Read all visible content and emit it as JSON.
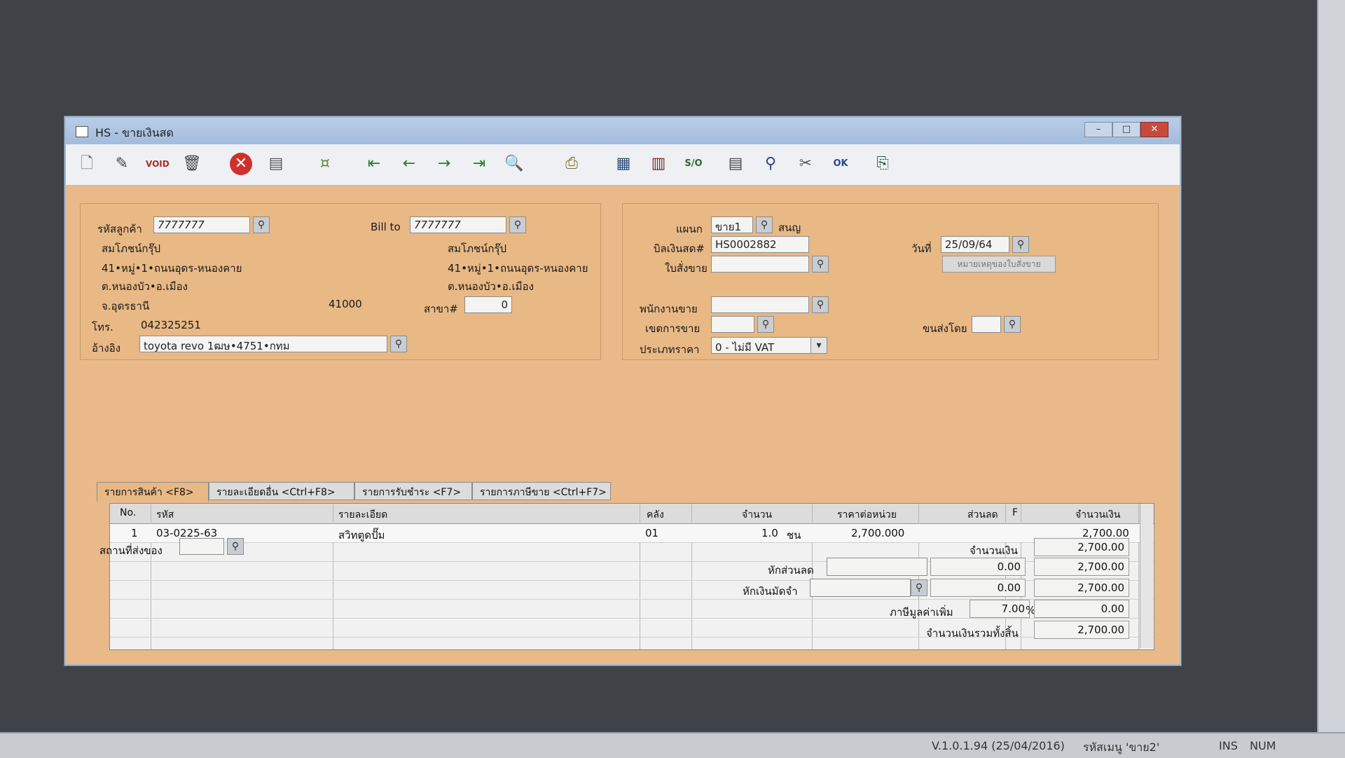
{
  "window": {
    "title": "HS - ขายเงินสด"
  },
  "toolbar": {
    "icons": [
      "new-icon",
      "edit-icon",
      "void-icon",
      "trash-icon",
      "cancel-icon",
      "save-icon",
      "money-icon",
      "first-icon",
      "prev-icon",
      "next-icon",
      "last-icon",
      "preview-icon",
      "print-icon",
      "report-icon",
      "card-icon",
      "so-icon",
      "document-icon",
      "lookup-icon",
      "tools-icon",
      "ok-icon",
      "export-icon"
    ]
  },
  "customer": {
    "code_label": "รหัสลูกค้า",
    "code": "7777777",
    "billto_label": "Bill to",
    "billto": "7777777",
    "name": "สมโภชน์กรุ๊ป",
    "addr1": "41•หมู่•1•ถนนอุดร-หนองคาย",
    "addr2": "ต.หนองบัว•อ.เมือง",
    "addr3": "จ.อุดรธานี",
    "zip": "41000",
    "branch_label": "สาขา#",
    "branch": "0",
    "phone_label": "โทร.",
    "phone": "042325251",
    "ref_label": "อ้างอิง",
    "ref": "toyota revo 1ฒษ•4751•กทม",
    "bill_name": "สมโภชน์กรุ๊ป",
    "bill_addr1": "41•หมู่•1•ถนนอุดร-หนองคาย",
    "bill_addr2": "ต.หนองบัว•อ.เมือง"
  },
  "doc": {
    "dept_label": "แผนก",
    "dept": "ขาย1",
    "dept_name": "สนญ",
    "bill_label": "บิลเงินสด#",
    "bill": "HS0002882",
    "date_label": "วันที่",
    "date": "25/09/64",
    "so_label": "ใบสั่งขาย",
    "so_note_btn": "หมายเหตุของใบสั่งขาย",
    "sales_label": "พนักงานขาย",
    "area_label": "เขตการขาย",
    "ship_label": "ขนส่งโดย",
    "price_type_label": "ประเภทราคา",
    "price_type": "0 - ไม่มี VAT"
  },
  "tabs": [
    "รายการสินค้า <F8>",
    "รายละเอียดอื่น <Ctrl+F8>",
    "รายการรับชำระ <F7>",
    "รายการภาษีขาย <Ctrl+F7>"
  ],
  "grid": {
    "headers": [
      "No.",
      "รหัส",
      "รายละเอียด",
      "คลัง",
      "จำนวน",
      "ราคาต่อหน่วย",
      "ส่วนลด",
      "F",
      "จำนวนเงิน"
    ],
    "rows": [
      {
        "no": "1",
        "code": "03-0225-63",
        "desc": "สวิทตูดปั๊ม",
        "wh": "01",
        "qty": "1.0",
        "unit": "ชน",
        "price": "2,700.000",
        "disc": "",
        "f": "",
        "amount": "2,700.00"
      }
    ]
  },
  "bottom": {
    "ship_place_label": "สถานที่ส่งของ",
    "amount_label": "จำนวนเงิน",
    "amount": "2,700.00",
    "discount_label": "หักส่วนลด",
    "discount": "0.00",
    "after_discount": "2,700.00",
    "deposit_label": "หักเงินมัดจำ",
    "deposit": "0.00",
    "after_deposit": "2,700.00",
    "vat_label": "ภาษีมูลค่าเพิ่ม",
    "vat_rate": "7.00",
    "vat_pct": "%",
    "vat": "0.00",
    "total_label": "จำนวนเงินรวมทั้งสิ้น",
    "total": "2,700.00"
  },
  "statusbar": {
    "version": "V.1.0.1.94 (25/04/2016)",
    "user": "รหัสเมนู 'ขาย2'",
    "ins": "INS",
    "num": "NUM"
  }
}
